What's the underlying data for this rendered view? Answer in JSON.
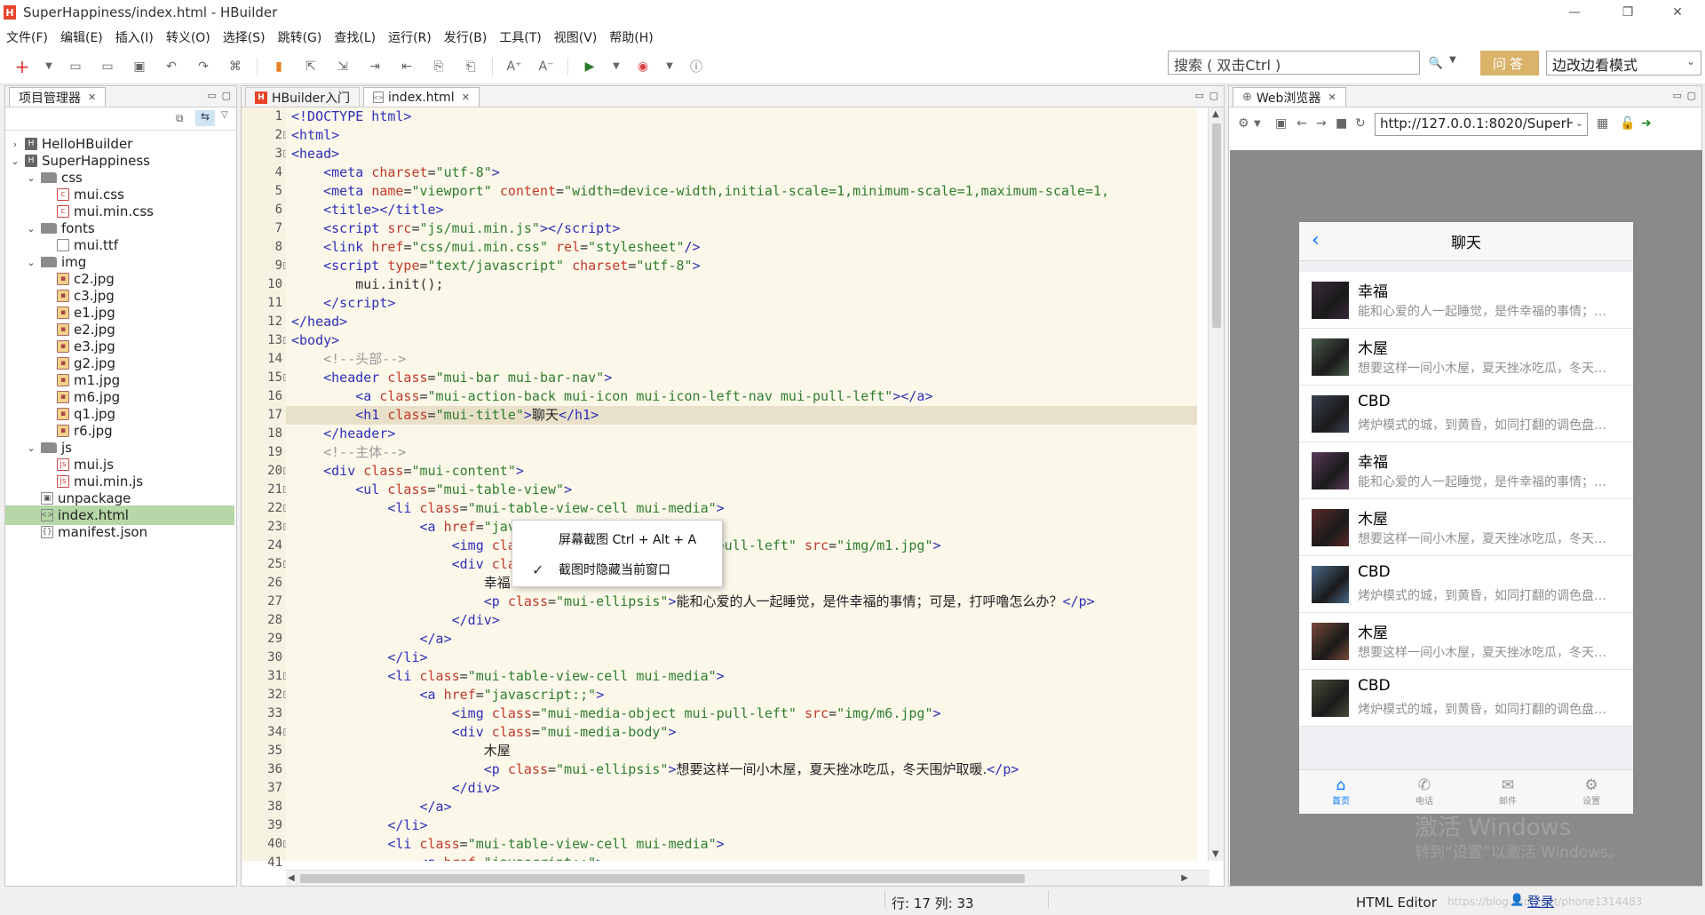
{
  "window": {
    "title": "SuperHappiness/index.html  -  HBuilder",
    "logo": "H",
    "minimize": "—",
    "restore": "❐",
    "close": "✕"
  },
  "menu": [
    "文件(F)",
    "编辑(E)",
    "插入(I)",
    "转义(O)",
    "选择(S)",
    "跳转(G)",
    "查找(L)",
    "运行(R)",
    "发行(B)",
    "工具(T)",
    "视图(V)",
    "帮助(H)"
  ],
  "toolbar": {
    "search_placeholder": "搜索 ( 双击Ctrl )",
    "ask_label": "问答",
    "mode_value": "边改边看模式"
  },
  "project": {
    "tab_label": "项目管理器",
    "items": [
      {
        "label": "HelloHBuilder",
        "icon": "project-icon",
        "twisty": "›"
      },
      {
        "label": "SuperHappiness",
        "icon": "project-icon",
        "twisty": "⌄"
      },
      {
        "label": "css",
        "icon": "folder-icon",
        "twisty": "⌄"
      },
      {
        "label": "mui.css",
        "icon": "css-file-icon",
        "twisty": ""
      },
      {
        "label": "mui.min.css",
        "icon": "css-file-icon",
        "twisty": ""
      },
      {
        "label": "fonts",
        "icon": "folder-icon",
        "twisty": "⌄"
      },
      {
        "label": "mui.ttf",
        "icon": "file-icon",
        "twisty": ""
      },
      {
        "label": "img",
        "icon": "folder-icon",
        "twisty": "⌄"
      },
      {
        "label": "c2.jpg",
        "icon": "image-file-icon",
        "twisty": ""
      },
      {
        "label": "c3.jpg",
        "icon": "image-file-icon",
        "twisty": ""
      },
      {
        "label": "e1.jpg",
        "icon": "image-file-icon",
        "twisty": ""
      },
      {
        "label": "e2.jpg",
        "icon": "image-file-icon",
        "twisty": ""
      },
      {
        "label": "e3.jpg",
        "icon": "image-file-icon",
        "twisty": ""
      },
      {
        "label": "g2.jpg",
        "icon": "image-file-icon",
        "twisty": ""
      },
      {
        "label": "m1.jpg",
        "icon": "image-file-icon",
        "twisty": ""
      },
      {
        "label": "m6.jpg",
        "icon": "image-file-icon",
        "twisty": ""
      },
      {
        "label": "q1.jpg",
        "icon": "image-file-icon",
        "twisty": ""
      },
      {
        "label": "r6.jpg",
        "icon": "image-file-icon",
        "twisty": ""
      },
      {
        "label": "js",
        "icon": "folder-icon",
        "twisty": "⌄"
      },
      {
        "label": "mui.js",
        "icon": "js-file-icon",
        "twisty": ""
      },
      {
        "label": "mui.min.js",
        "icon": "js-file-icon",
        "twisty": ""
      },
      {
        "label": "unpackage",
        "icon": "package-icon",
        "twisty": ""
      },
      {
        "label": "index.html",
        "icon": "html-file-icon",
        "twisty": ""
      },
      {
        "label": "manifest.json",
        "icon": "json-file-icon",
        "twisty": ""
      }
    ]
  },
  "editor": {
    "tabs": [
      "HBuilder入门",
      "index.html"
    ],
    "line_numbers": [
      "1",
      "2",
      "3",
      "4",
      "5",
      "6",
      "7",
      "8",
      "9",
      "10",
      "11",
      "12",
      "13",
      "14",
      "15",
      "16",
      "17",
      "18",
      "19",
      "20",
      "21",
      "22",
      "23",
      "24",
      "25",
      "26",
      "27",
      "28",
      "29",
      "30",
      "31",
      "32",
      "33",
      "34",
      "35",
      "36",
      "37",
      "38",
      "39",
      "40",
      "41"
    ]
  },
  "context_menu": {
    "item1": "屏幕截图 Ctrl + Alt + A",
    "item2": "截图时隐藏当前窗口",
    "check": "✓"
  },
  "browser": {
    "tab_label": "Web浏览器",
    "url": "http://127.0.0.1:8020/SuperH",
    "page_title": "聊天",
    "back": "‹",
    "chats": [
      {
        "name": "幸福",
        "desc": "能和心爱的人一起睡觉，是件幸福的事情；可是，打呼噜怎么办？",
        "color": "#3a2a3a"
      },
      {
        "name": "木屋",
        "desc": "想要这样一间小木屋，夏天挫冰吃瓜，冬天围炉取暖。",
        "color": "#4a5a4a"
      },
      {
        "name": "CBD",
        "desc": "烤炉模式的城，到黄昏，如同打翻的调色盘一般。",
        "color": "#3a4050"
      },
      {
        "name": "幸福",
        "desc": "能和心爱的人一起睡觉，是件幸福的事情；可是，打呼噜怎么办？",
        "color": "#5a3a5a"
      },
      {
        "name": "木屋",
        "desc": "想要这样一间小木屋，夏天挫冰吃瓜，冬天围炉取暖。",
        "color": "#5a2a2a"
      },
      {
        "name": "CBD",
        "desc": "烤炉模式的城，到黄昏，如同打翻的调色盘一般。",
        "color": "#4a6a8a"
      },
      {
        "name": "木屋",
        "desc": "想要这样一间小木屋，夏天挫冰吃瓜，冬天围炉取暖。",
        "color": "#7a4a3a"
      },
      {
        "name": "CBD",
        "desc": "烤炉模式的城，到黄昏，如同打翻的调色盘一般。",
        "color": "#4a4a3a"
      }
    ],
    "tabbar": [
      {
        "label": "首页",
        "icon": "⌂"
      },
      {
        "label": "电话",
        "icon": "✆"
      },
      {
        "label": "邮件",
        "icon": "✉"
      },
      {
        "label": "设置",
        "icon": "⚙"
      }
    ],
    "watermark1": "激活 Windows",
    "watermark2": "转到“设置”以激活 Windows。"
  },
  "status": {
    "position": "行: 17 列: 33",
    "editor_type": "HTML Editor",
    "login": "登录",
    "blog": "https://blog.csdn.net/phone1314483"
  },
  "colors": {
    "accent": "#d9b36a",
    "selection": "#b6d7a8",
    "current_line": "#e8e0c8",
    "ios_blue": "#007aff"
  }
}
